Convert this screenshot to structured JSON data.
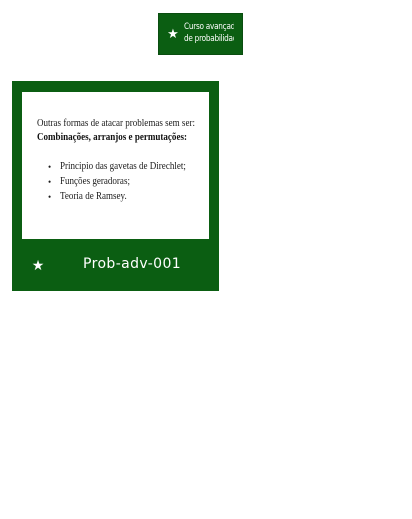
{
  "badge": {
    "icon": "star-icon",
    "line1": "Curso avançado",
    "line2": "de probabilidade"
  },
  "card": {
    "slide": {
      "intro": "Outras formas de atacar problemas sem ser:",
      "heading": "Combinações, arranjos e permutações:",
      "bullets": [
        "Principio das gavetas de Direchlet;",
        "Funções geradoras;",
        "Teoria de Ramsey."
      ]
    },
    "icon": "star-icon",
    "code": "Prob-adv-001"
  },
  "colors": {
    "brand_green": "#0b5e12",
    "text_on_green": "#ffffff"
  }
}
